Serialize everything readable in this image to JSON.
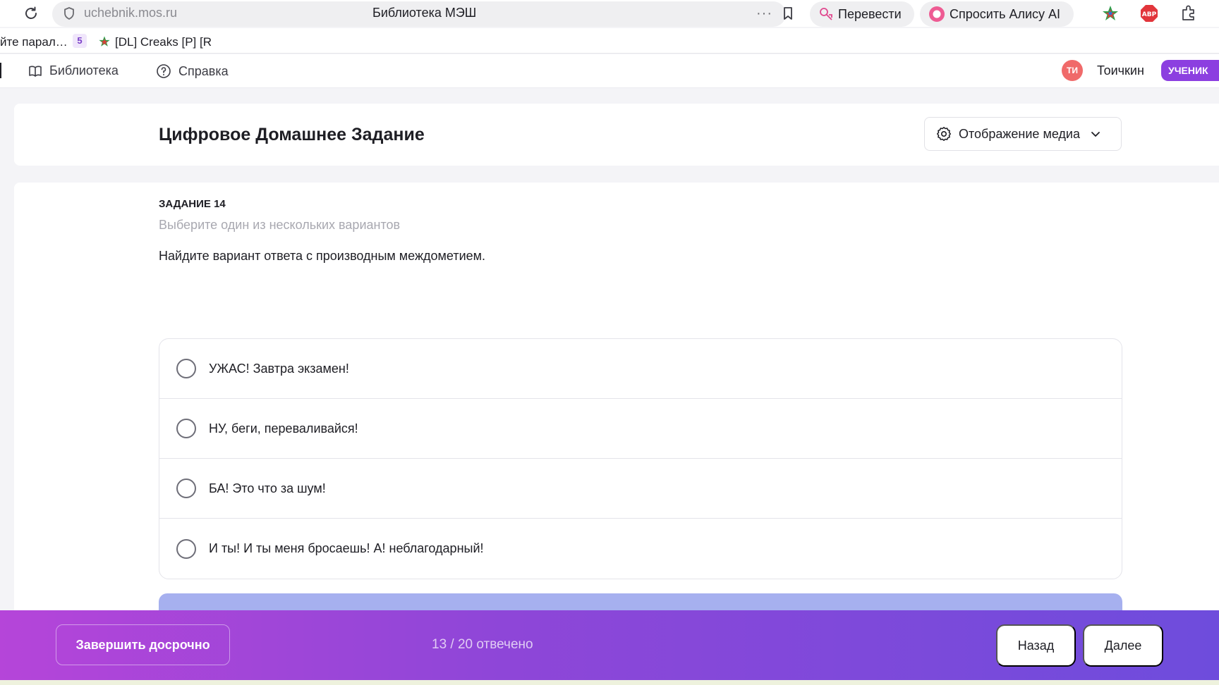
{
  "browser": {
    "url": "uchebnik.mos.ru",
    "tab_title": "Библиотека МЭШ",
    "more_label": "···",
    "translate_label": "Перевести",
    "alice_label": "Спросить Алису AI"
  },
  "bookmarks": {
    "item1": "йте парал…",
    "item2_badge": "5",
    "item3": "[DL] Creaks [P] [R"
  },
  "app_header": {
    "nav": [
      {
        "label": "Библиотека",
        "icon": "book-icon"
      },
      {
        "label": "Справка",
        "icon": "help-icon"
      }
    ],
    "avatar_initials": "ТИ",
    "user_name": "Тоичкин",
    "role": "УЧЕНИК",
    "avatar_color": "#f06a6a",
    "role_color": "#8c3fe0"
  },
  "title_card": {
    "title": "Цифровое Домашнее Задание",
    "media_label": "Отображение медиа"
  },
  "task": {
    "number": "ЗАДАНИЕ 14",
    "hint": "Выберите один из нескольких вариантов",
    "question": "Найдите вариант ответа с производным междометием.",
    "options": [
      {
        "label": "УЖАС! Завтра экзамен!",
        "selected": false
      },
      {
        "label": "НУ, беги, переваливайся!",
        "selected": false
      },
      {
        "label": "БА! Это что за шум!",
        "selected": false
      },
      {
        "label": "И ты! И ты меня бросаешь! А! неблагодарный!",
        "selected": false
      }
    ]
  },
  "footer": {
    "finish_label": "Завершить досрочно",
    "progress_text": "13 / 20 отвечено",
    "back_label": "Назад",
    "next_label": "Далее",
    "gradient_start": "#b545d9",
    "gradient_end": "#6e4cdc"
  }
}
